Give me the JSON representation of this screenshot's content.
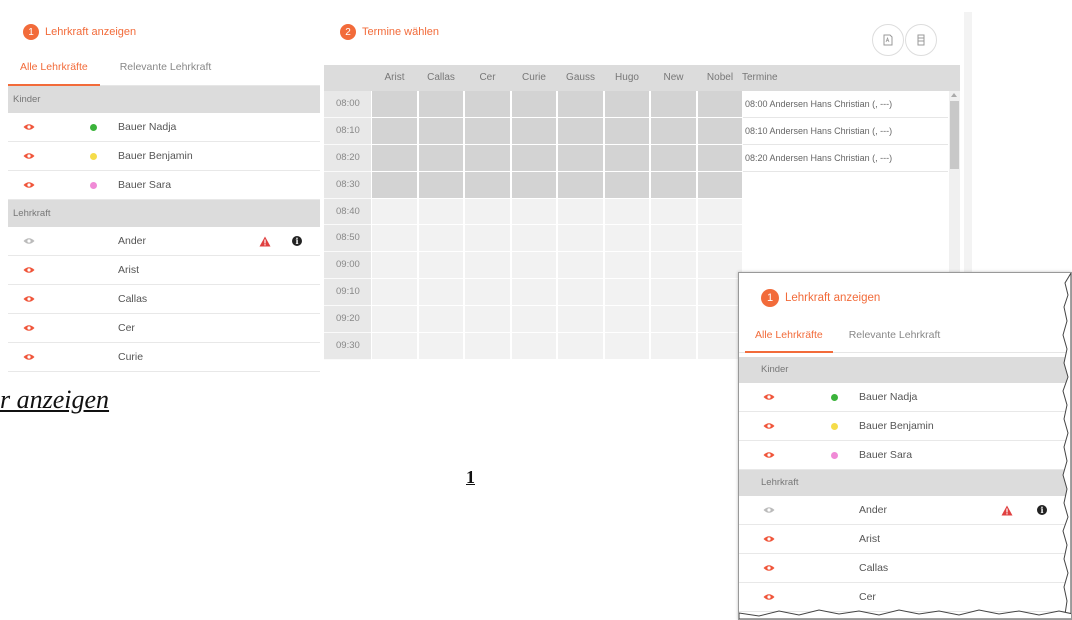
{
  "panel1": {
    "step_number": "1",
    "title": "Lehrkraft anzeigen",
    "tabs": [
      {
        "label": "Alle Lehrkräfte",
        "active": true
      },
      {
        "label": "Relevante Lehrkraft",
        "active": false
      }
    ],
    "kinder_section": "Kinder",
    "kinder": [
      {
        "name": "Bauer Nadja",
        "color": "#3bb33b"
      },
      {
        "name": "Bauer Benjamin",
        "color": "#f5dc4a"
      },
      {
        "name": "Bauer Sara",
        "color": "#f08ad6"
      }
    ],
    "lehrkraft_section": "Lehrkraft",
    "lehrkraefte": [
      {
        "name": "Ander",
        "visible": false,
        "warning": true,
        "info": true
      },
      {
        "name": "Arist",
        "visible": true
      },
      {
        "name": "Callas",
        "visible": true
      },
      {
        "name": "Cer",
        "visible": true
      },
      {
        "name": "Curie",
        "visible": true
      }
    ]
  },
  "panel2": {
    "step_number": "2",
    "title": "Termine wählen",
    "icons": [
      "pdf-icon",
      "print-icon"
    ],
    "columns": [
      "Arist",
      "Callas",
      "Cer",
      "Curie",
      "Gauss",
      "Hugo",
      "New",
      "Nobel"
    ],
    "termine_header": "Termine",
    "times": [
      "08:00",
      "08:10",
      "08:20",
      "08:30",
      "08:40",
      "08:50",
      "09:00",
      "09:10",
      "09:20",
      "09:30"
    ],
    "busy_rows": 4,
    "termine": [
      "08:00 Andersen Hans Christian (, ---)",
      "08:10 Andersen Hans Christian (, ---)",
      "08:20 Andersen Hans Christian (, ---)"
    ]
  },
  "doc": {
    "italic_fragment": "r anzeigen",
    "page_number": "1"
  },
  "callout": {
    "step_number": "1",
    "title": "Lehrkraft anzeigen",
    "tabs": [
      {
        "label": "Alle Lehrkräfte",
        "active": true
      },
      {
        "label": "Relevante Lehrkraft",
        "active": false
      }
    ],
    "kinder_section": "Kinder",
    "kinder": [
      {
        "name": "Bauer Nadja",
        "color": "#3bb33b"
      },
      {
        "name": "Bauer Benjamin",
        "color": "#f5dc4a"
      },
      {
        "name": "Bauer Sara",
        "color": "#f08ad6"
      }
    ],
    "lehrkraft_section": "Lehrkraft",
    "lehrkraefte": [
      {
        "name": "Ander",
        "visible": false,
        "warning": true,
        "info": true
      },
      {
        "name": "Arist",
        "visible": true
      },
      {
        "name": "Callas",
        "visible": true
      },
      {
        "name": "Cer",
        "visible": true
      }
    ]
  },
  "colors": {
    "accent": "#f26b3a",
    "eye_active": "#f0553a",
    "eye_inactive": "#bbbbbb",
    "warning": "#e04040"
  }
}
